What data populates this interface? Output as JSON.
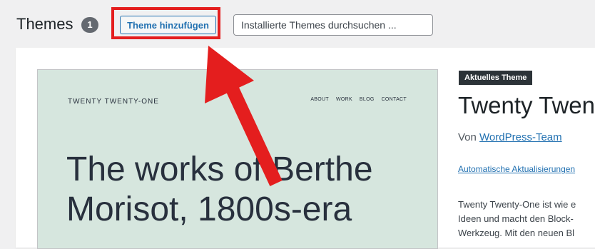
{
  "header": {
    "title": "Themes",
    "count": "1",
    "add_button_label": "Theme hinzufügen",
    "search_placeholder": "Installierte Themes durchsuchen ..."
  },
  "theme_screenshot": {
    "site_title": "TWENTY TWENTY-ONE",
    "nav_items": [
      "ABOUT",
      "WORK",
      "BLOG",
      "CONTACT"
    ],
    "headline_lines": [
      "The works of Berthe",
      "Morisot, 1800s-era"
    ]
  },
  "theme_details": {
    "badge": "Aktuelles Theme",
    "name": "Twenty Twenty-",
    "author_prefix": "Von",
    "author_link": "WordPress-Team",
    "auto_update_link": "Automatische Aktualisierungen",
    "description_lines": [
      "Twenty Twenty-One ist wie e",
      "Ideen und macht den Block-",
      "Werkzeug. Mit den neuen Bl"
    ]
  },
  "colors": {
    "accent_blue": "#2271b1",
    "highlight_red": "#e41e1e",
    "screenshot_background": "#d6e6de"
  }
}
